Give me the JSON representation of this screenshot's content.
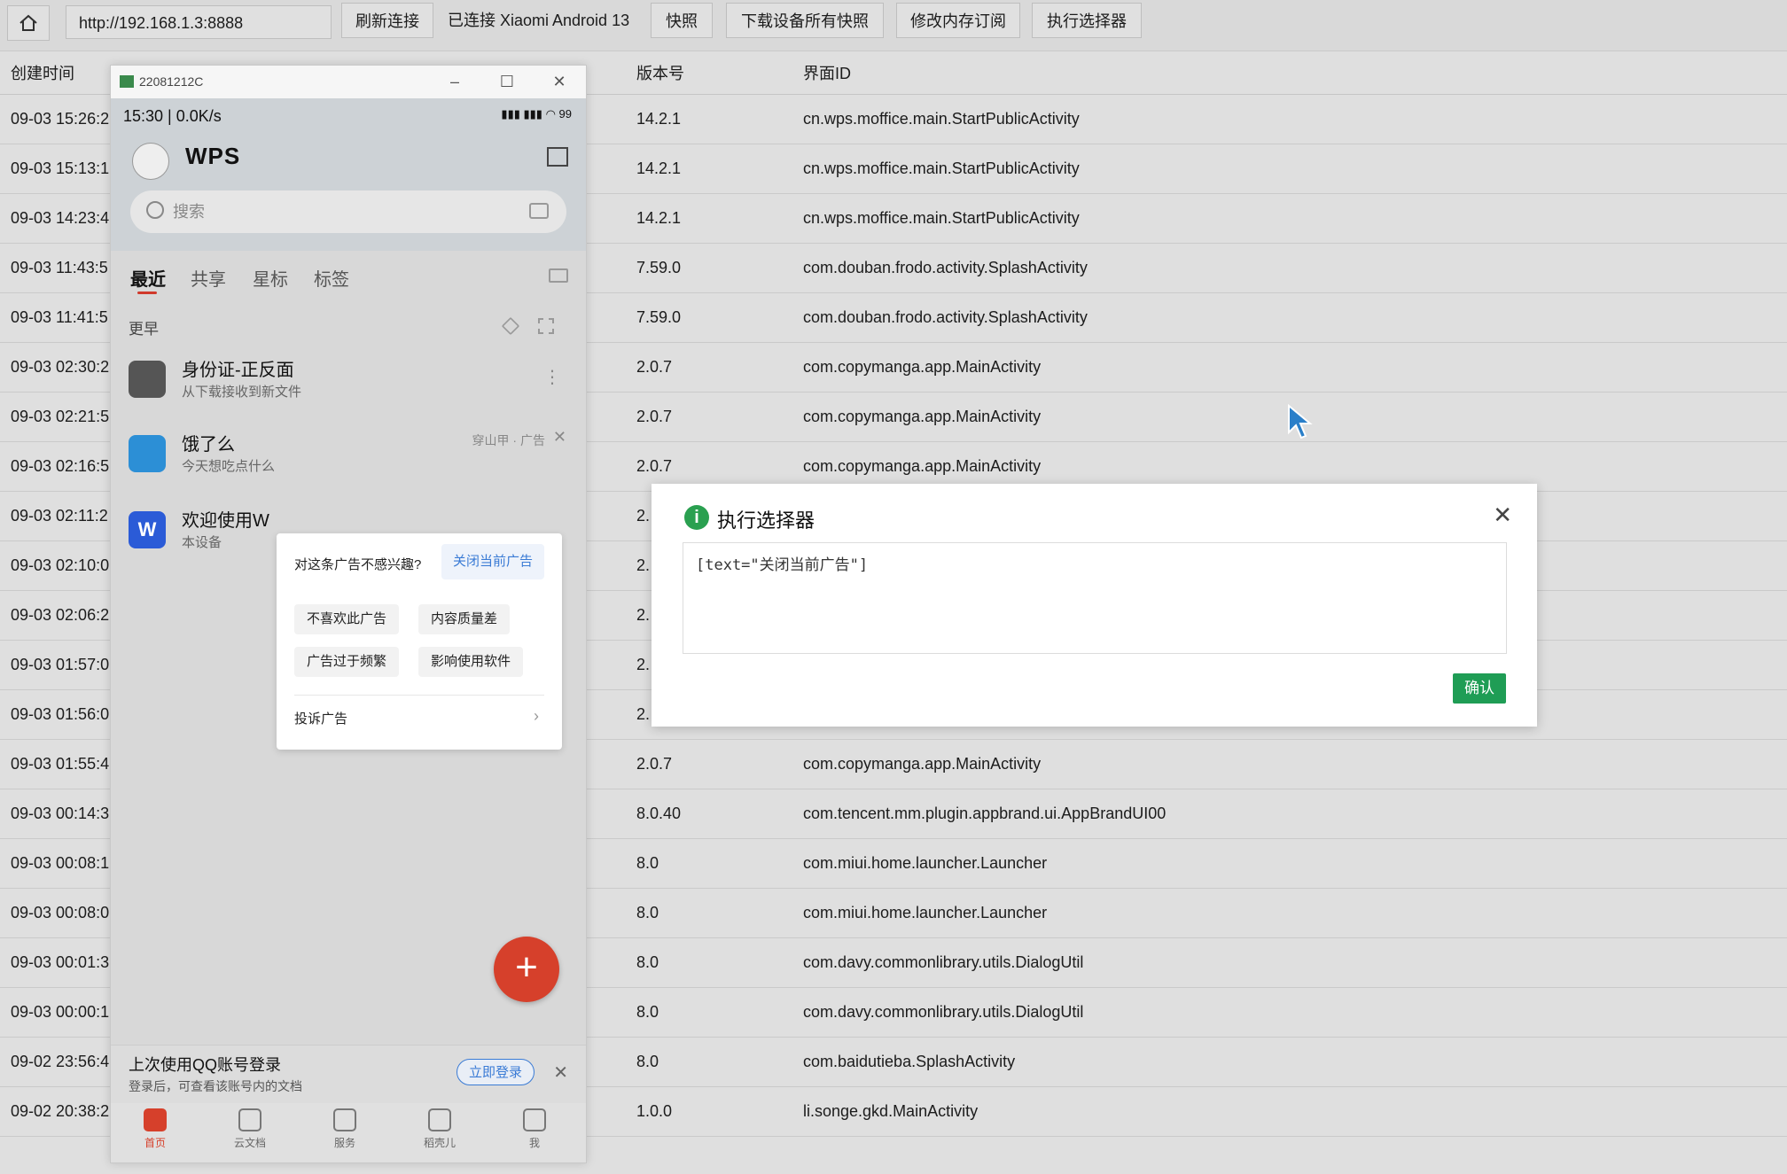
{
  "topbar": {
    "url": "http://192.168.1.3:8888",
    "refresh": "刷新连接",
    "status": "已连接 Xiaomi Android 13",
    "snapshot": "快照",
    "download_all": "下载设备所有快照",
    "modify_sub": "修改内存订阅",
    "exec_selector": "执行选择器"
  },
  "table": {
    "headers": {
      "time": "创建时间",
      "version": "版本号",
      "activity": "界面ID"
    },
    "rows": [
      {
        "time": "09-03 15:26:2",
        "version": "14.2.1",
        "activity": "cn.wps.moffice.main.StartPublicActivity"
      },
      {
        "time": "09-03 15:13:1",
        "version": "14.2.1",
        "activity": "cn.wps.moffice.main.StartPublicActivity"
      },
      {
        "time": "09-03 14:23:4",
        "version": "14.2.1",
        "activity": "cn.wps.moffice.main.StartPublicActivity"
      },
      {
        "time": "09-03 11:43:5",
        "version": "7.59.0",
        "activity": "com.douban.frodo.activity.SplashActivity"
      },
      {
        "time": "09-03 11:41:5",
        "version": "7.59.0",
        "activity": "com.douban.frodo.activity.SplashActivity"
      },
      {
        "time": "09-03 02:30:2",
        "version": "2.0.7",
        "activity": "com.copymanga.app.MainActivity"
      },
      {
        "time": "09-03 02:21:5",
        "version": "2.0.7",
        "activity": "com.copymanga.app.MainActivity"
      },
      {
        "time": "09-03 02:16:5",
        "version": "2.0.7",
        "activity": "com.copymanga.app.MainActivity"
      },
      {
        "time": "09-03 02:11:2",
        "version": "2.",
        "activity": ""
      },
      {
        "time": "09-03 02:10:0",
        "version": "2.",
        "activity": ""
      },
      {
        "time": "09-03 02:06:2",
        "version": "2.",
        "activity": ""
      },
      {
        "time": "09-03 01:57:0",
        "version": "2.",
        "activity": ""
      },
      {
        "time": "09-03 01:56:0",
        "version": "2.",
        "activity": ""
      },
      {
        "time": "09-03 01:55:4",
        "version": "2.0.7",
        "activity": "com.copymanga.app.MainActivity"
      },
      {
        "time": "09-03 00:14:3",
        "version": "8.0.40",
        "activity": "com.tencent.mm.plugin.appbrand.ui.AppBrandUI00"
      },
      {
        "time": "09-03 00:08:1",
        "version": "8.0",
        "activity": "com.miui.home.launcher.Launcher"
      },
      {
        "time": "09-03 00:08:0",
        "version": "8.0",
        "activity": "com.miui.home.launcher.Launcher"
      },
      {
        "time": "09-03 00:01:3",
        "version": "8.0",
        "activity": "com.davy.commonlibrary.utils.DialogUtil"
      },
      {
        "time": "09-03 00:00:1",
        "version": "8.0",
        "activity": "com.davy.commonlibrary.utils.DialogUtil"
      },
      {
        "time": "09-02 23:56:4",
        "version": "8.0",
        "activity": "com.baidutieba.SplashActivity"
      },
      {
        "time": "09-02 20:38:2",
        "version": "1.0.0",
        "activity": "li.songe.gkd.MainActivity"
      }
    ]
  },
  "phone": {
    "window_title": "22081212C",
    "status_time": "15:30 | 0.0K/s",
    "battery": "99",
    "app_logo_text": "WPS",
    "search_placeholder": "搜索",
    "tabs": [
      "最近",
      "共享",
      "星标",
      "标签"
    ],
    "section": "更早",
    "files": [
      {
        "name": "身份证-正反面",
        "sub": "从下载接收到新文件"
      },
      {
        "name": "饿了么",
        "sub": "今天想吃点什么",
        "ad_tag": "穿山甲 · 广告"
      },
      {
        "name": "欢迎使用W",
        "sub": "本设备"
      }
    ],
    "popup": {
      "question": "对这条广告不感兴趣?",
      "close_ad": "关闭当前广告",
      "options": [
        "不喜欢此广告",
        "内容质量差",
        "广告过于频繁",
        "影响使用软件"
      ],
      "report": "投诉广告"
    },
    "fab": "+",
    "banner": {
      "title": "上次使用QQ账号登录",
      "sub": "登录后，可查看该账号内的文档",
      "button": "立即登录"
    },
    "nav": [
      "首页",
      "云文档",
      "服务",
      "稻壳儿",
      "我"
    ]
  },
  "dialog": {
    "title": "执行选择器",
    "content": "[text=\"关闭当前广告\"]",
    "confirm": "确认"
  },
  "colors": {
    "accent_green": "#1f9d55",
    "wps_red": "#d6402b",
    "link_blue": "#3a7bd5"
  }
}
